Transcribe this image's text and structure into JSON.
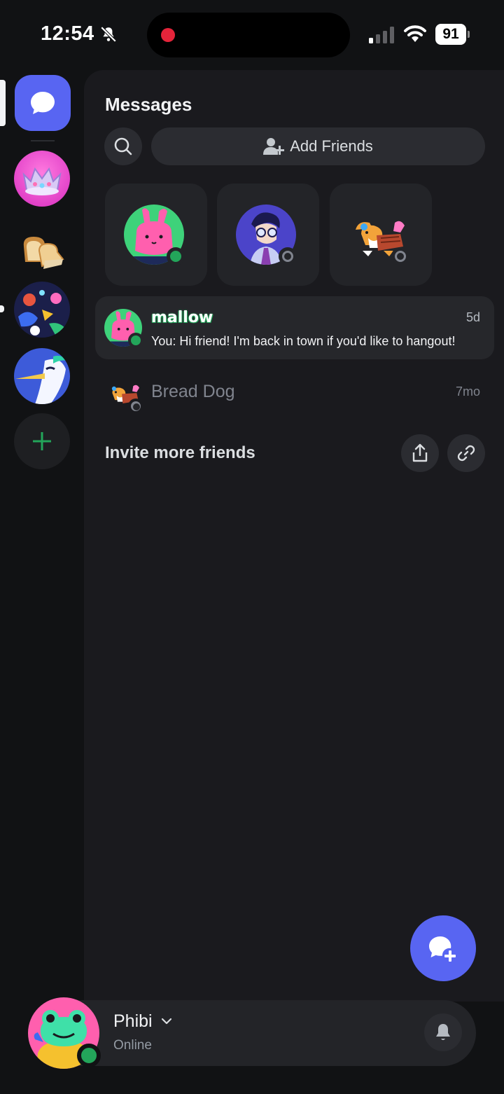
{
  "status_bar": {
    "time": "12:54",
    "battery": "91"
  },
  "rail": {
    "servers": [
      {
        "name": "crown-server"
      },
      {
        "name": "bread-server"
      },
      {
        "name": "art-server"
      },
      {
        "name": "bird-server"
      }
    ]
  },
  "header": {
    "title": "Messages",
    "add_friends_label": "Add Friends"
  },
  "dms": [
    {
      "name": "mallow",
      "time": "5d",
      "preview": "You: Hi friend! I'm back in town if you'd like to hangout!"
    },
    {
      "name": "Bread Dog",
      "time": "7mo"
    }
  ],
  "invite": {
    "label": "Invite more friends"
  },
  "user": {
    "name": "Phibi",
    "status": "Online"
  },
  "colors": {
    "accent": "#5865f2",
    "online": "#23a55a",
    "offline": "#80848e"
  }
}
